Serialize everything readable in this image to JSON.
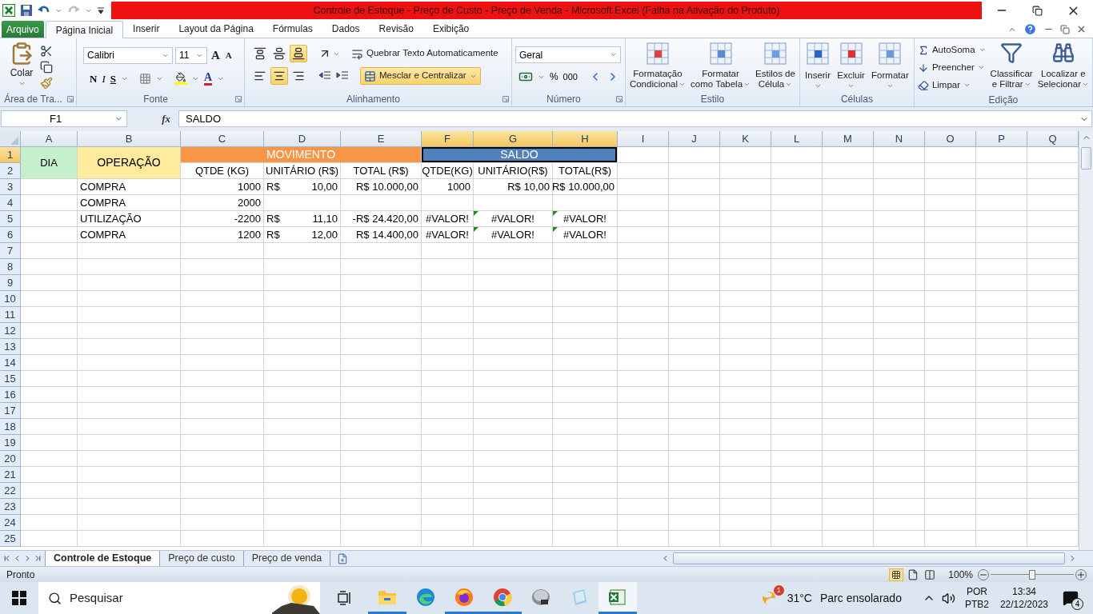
{
  "window": {
    "title": "Controle de Estoque - Preço de Custo - Preço de Venda  -  Microsoft Excel (Falha na Ativação do Produto)"
  },
  "ribbon_tabs": [
    {
      "label": "Arquivo",
      "kind": "file",
      "selected": false
    },
    {
      "label": "Página Inicial",
      "kind": "tab",
      "selected": true
    },
    {
      "label": "Inserir",
      "kind": "tab",
      "selected": false
    },
    {
      "label": "Layout da Página",
      "kind": "tab",
      "selected": false
    },
    {
      "label": "Fórmulas",
      "kind": "tab",
      "selected": false
    },
    {
      "label": "Dados",
      "kind": "tab",
      "selected": false
    },
    {
      "label": "Revisão",
      "kind": "tab",
      "selected": false
    },
    {
      "label": "Exibição",
      "kind": "tab",
      "selected": false
    }
  ],
  "ribbon_groups": [
    {
      "kind": "clipboard",
      "label": "Área de Tra...",
      "paste": "Colar"
    },
    {
      "kind": "font",
      "label": "Fonte",
      "font_name": "Calibri",
      "font_size": "11",
      "grow": "A",
      "shrink": "A",
      "bold": "N",
      "italic": "I",
      "underline": "S",
      "font_color": "A"
    },
    {
      "kind": "alignment",
      "label": "Alinhamento",
      "wrap_text": "Quebrar Texto Automaticamente",
      "merge": "Mesclar e Centralizar",
      "merge_selected": true,
      "vertical": [
        {
          "selected": false
        },
        {
          "selected": false
        },
        {
          "selected": true
        }
      ],
      "horizontal": [
        {
          "selected": false
        },
        {
          "selected": true
        },
        {
          "selected": false
        }
      ]
    },
    {
      "kind": "number",
      "label": "Número",
      "format": "Geral",
      "percent": "%",
      "thousands": "000"
    },
    {
      "kind": "styles",
      "label": "Estilo",
      "buttons": [
        {
          "lines": [
            "Formatação",
            "Condicional"
          ]
        },
        {
          "lines": [
            "Formatar",
            "como Tabela"
          ]
        },
        {
          "lines": [
            "Estilos de",
            "Célula"
          ]
        }
      ]
    },
    {
      "kind": "cells",
      "label": "Células",
      "buttons": [
        {
          "label": "Inserir"
        },
        {
          "label": "Excluir"
        },
        {
          "label": "Formatar"
        }
      ]
    },
    {
      "kind": "editing",
      "label": "Edição",
      "small": [
        {
          "label": "AutoSoma"
        },
        {
          "label": "Preencher"
        },
        {
          "label": "Limpar"
        }
      ],
      "big": [
        {
          "lines": [
            "Classificar",
            "e Filtrar"
          ]
        },
        {
          "lines": [
            "Localizar e",
            "Selecionar"
          ]
        }
      ]
    }
  ],
  "formula_bar": {
    "name_box": "F1",
    "function_label": "fx",
    "formula": "SALDO"
  },
  "sheet": {
    "columns": [
      {
        "label": "A",
        "selected": false
      },
      {
        "label": "B",
        "selected": false
      },
      {
        "label": "C",
        "selected": false
      },
      {
        "label": "D",
        "selected": false
      },
      {
        "label": "E",
        "selected": false
      },
      {
        "label": "F",
        "selected": true
      },
      {
        "label": "G",
        "selected": true
      },
      {
        "label": "H",
        "selected": true
      },
      {
        "label": "I",
        "selected": false
      },
      {
        "label": "J",
        "selected": false
      },
      {
        "label": "K",
        "selected": false
      },
      {
        "label": "L",
        "selected": false
      },
      {
        "label": "M",
        "selected": false
      },
      {
        "label": "N",
        "selected": false
      },
      {
        "label": "O",
        "selected": false
      },
      {
        "label": "P",
        "selected": false
      },
      {
        "label": "Q",
        "selected": false
      }
    ],
    "rows": [
      {
        "label": "1",
        "selected": true,
        "cells": [
          {
            "kind": "good",
            "text": "DIA"
          },
          {
            "kind": "neutral",
            "text": "OPERAÇÃO"
          },
          {
            "kind": "band",
            "text": "MOVIMENTO",
            "color": "#f79646",
            "selected": false
          },
          {
            "kind": "merged_left"
          },
          {
            "kind": "merged_left"
          },
          {
            "kind": "band",
            "text": "SALDO",
            "color": "#4f81bd",
            "selected": true
          },
          {
            "kind": "merged_left"
          },
          {
            "kind": "merged_left"
          }
        ]
      },
      {
        "label": "2",
        "selected": false,
        "cells": [
          {
            "kind": "merged_up"
          },
          {
            "kind": "merged_up"
          },
          {
            "kind": "heading",
            "text": "QTDE (KG)"
          },
          {
            "kind": "heading",
            "text": "UNITÁRIO (R$)"
          },
          {
            "kind": "heading",
            "text": "TOTAL (R$)"
          },
          {
            "kind": "heading",
            "text": "QTDE(KG)"
          },
          {
            "kind": "heading",
            "text": "UNITÁRIO(R$)"
          },
          {
            "kind": "heading",
            "text": "TOTAL(R$)"
          }
        ]
      },
      {
        "label": "3",
        "selected": false,
        "cells": [
          {
            "kind": "empty"
          },
          {
            "kind": "text",
            "text": "COMPRA"
          },
          {
            "kind": "number",
            "text": "1000"
          },
          {
            "kind": "accounting",
            "symbol": "R$",
            "amount": "10,00"
          },
          {
            "kind": "number",
            "text": "R$ 10.000,00"
          },
          {
            "kind": "number",
            "text": "1000"
          },
          {
            "kind": "number",
            "text": "R$ 10,00"
          },
          {
            "kind": "number",
            "text": "R$ 10.000,00"
          }
        ]
      },
      {
        "label": "4",
        "selected": false,
        "cells": [
          {
            "kind": "empty"
          },
          {
            "kind": "text",
            "text": "COMPRA"
          },
          {
            "kind": "number",
            "text": "2000"
          }
        ]
      },
      {
        "label": "5",
        "selected": false,
        "cells": [
          {
            "kind": "empty"
          },
          {
            "kind": "text",
            "text": "UTILIZAÇÃO"
          },
          {
            "kind": "number",
            "text": "-2200"
          },
          {
            "kind": "accounting",
            "symbol": "R$",
            "amount": "11,10"
          },
          {
            "kind": "number",
            "text": "-R$ 24.420,00"
          },
          {
            "kind": "error",
            "text": "#VALOR!",
            "flag": false
          },
          {
            "kind": "error",
            "text": "#VALOR!",
            "flag": true
          },
          {
            "kind": "error",
            "text": "#VALOR!",
            "flag": true
          }
        ]
      },
      {
        "label": "6",
        "selected": false,
        "cells": [
          {
            "kind": "empty"
          },
          {
            "kind": "text",
            "text": "COMPRA"
          },
          {
            "kind": "number",
            "text": "1200"
          },
          {
            "kind": "accounting",
            "symbol": "R$",
            "amount": "12,00"
          },
          {
            "kind": "number",
            "text": "R$ 14.400,00"
          },
          {
            "kind": "error",
            "text": "#VALOR!",
            "flag": false
          },
          {
            "kind": "error",
            "text": "#VALOR!",
            "flag": true
          },
          {
            "kind": "error",
            "text": "#VALOR!",
            "flag": true
          }
        ]
      },
      {
        "label": "7",
        "selected": false
      },
      {
        "label": "8",
        "selected": false
      },
      {
        "label": "9",
        "selected": false
      },
      {
        "label": "10",
        "selected": false
      },
      {
        "label": "11",
        "selected": false
      },
      {
        "label": "12",
        "selected": false
      },
      {
        "label": "13",
        "selected": false
      },
      {
        "label": "14",
        "selected": false
      },
      {
        "label": "15",
        "selected": false
      },
      {
        "label": "16",
        "selected": false
      },
      {
        "label": "17",
        "selected": false
      },
      {
        "label": "18",
        "selected": false
      },
      {
        "label": "19",
        "selected": false
      },
      {
        "label": "20",
        "selected": false
      },
      {
        "label": "21",
        "selected": false
      },
      {
        "label": "22",
        "selected": false
      },
      {
        "label": "23",
        "selected": false
      },
      {
        "label": "24",
        "selected": false
      },
      {
        "label": "25",
        "selected": false
      }
    ]
  },
  "sheet_tabs": [
    {
      "label": "Controle de Estoque",
      "selected": true
    },
    {
      "label": "Preço de custo",
      "selected": false
    },
    {
      "label": "Preço de venda",
      "selected": false
    }
  ],
  "status_bar": {
    "status": "Pronto",
    "views": [
      {
        "kind": "normal",
        "selected": true
      },
      {
        "kind": "page_layout",
        "selected": false
      },
      {
        "kind": "page_break",
        "selected": false
      }
    ],
    "zoom": "100%",
    "zoom_slider": {
      "level": 0.5
    }
  },
  "taskbar": {
    "search_placeholder": "Pesquisar",
    "apps": [
      {
        "kind": "explorer",
        "running": true,
        "selected": false
      },
      {
        "kind": "edge",
        "running": false,
        "selected": false
      },
      {
        "kind": "firefox",
        "running": true,
        "selected": false
      },
      {
        "kind": "chrome",
        "running": true,
        "selected": false
      },
      {
        "kind": "disk",
        "running": false,
        "selected": false
      },
      {
        "kind": "notepad",
        "running": false,
        "selected": false
      },
      {
        "kind": "excel",
        "running": true,
        "selected": true
      }
    ],
    "weather": {
      "temperature": "31°C",
      "condition": "Parc ensolarado",
      "badge": "1"
    },
    "language": [
      "POR",
      "PTB2"
    ],
    "time": "13:34",
    "date": "22/12/2023",
    "notifications": "4"
  }
}
